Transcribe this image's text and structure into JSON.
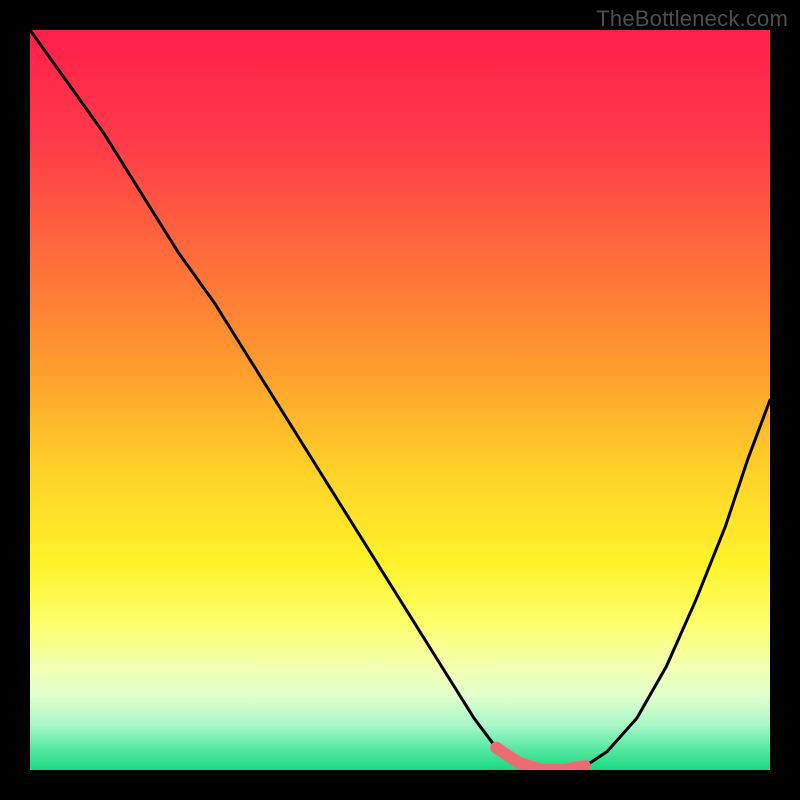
{
  "watermark": "TheBottleneck.com",
  "colors": {
    "black": "#000000",
    "curve_stroke": "#000000",
    "accent_red": "#ed6b72",
    "gradient_stops": [
      {
        "offset": 0.0,
        "color": "#ff1f4b"
      },
      {
        "offset": 0.15,
        "color": "#ff3a49"
      },
      {
        "offset": 0.3,
        "color": "#ff6a3c"
      },
      {
        "offset": 0.45,
        "color": "#ff9a2e"
      },
      {
        "offset": 0.6,
        "color": "#ffd328"
      },
      {
        "offset": 0.72,
        "color": "#fff22a"
      },
      {
        "offset": 0.8,
        "color": "#fdff6a"
      },
      {
        "offset": 0.86,
        "color": "#f4ffb0"
      },
      {
        "offset": 0.9,
        "color": "#e0ffcc"
      },
      {
        "offset": 0.94,
        "color": "#a8f7c8"
      },
      {
        "offset": 0.97,
        "color": "#5be9a4"
      },
      {
        "offset": 1.0,
        "color": "#18d97f"
      }
    ]
  },
  "chart_data": {
    "type": "line",
    "title": "",
    "xlabel": "",
    "ylabel": "",
    "xlim": [
      0,
      1
    ],
    "ylim": [
      0,
      1
    ],
    "grid": false,
    "series": [
      {
        "name": "bottleneck-curve",
        "x": [
          0.0,
          0.05,
          0.1,
          0.15,
          0.2,
          0.25,
          0.3,
          0.35,
          0.4,
          0.45,
          0.5,
          0.55,
          0.6,
          0.63,
          0.66,
          0.69,
          0.72,
          0.75,
          0.78,
          0.82,
          0.86,
          0.9,
          0.94,
          0.97,
          1.0
        ],
        "values": [
          1.0,
          0.93,
          0.86,
          0.78,
          0.7,
          0.63,
          0.55,
          0.47,
          0.39,
          0.31,
          0.23,
          0.15,
          0.07,
          0.03,
          0.01,
          0.0,
          0.0,
          0.005,
          0.025,
          0.07,
          0.14,
          0.23,
          0.33,
          0.42,
          0.5
        ]
      }
    ],
    "accent_segment": {
      "name": "valley-highlight",
      "x": [
        0.63,
        0.66,
        0.69,
        0.72,
        0.75
      ],
      "values": [
        0.03,
        0.01,
        0.0,
        0.0,
        0.005
      ]
    }
  }
}
